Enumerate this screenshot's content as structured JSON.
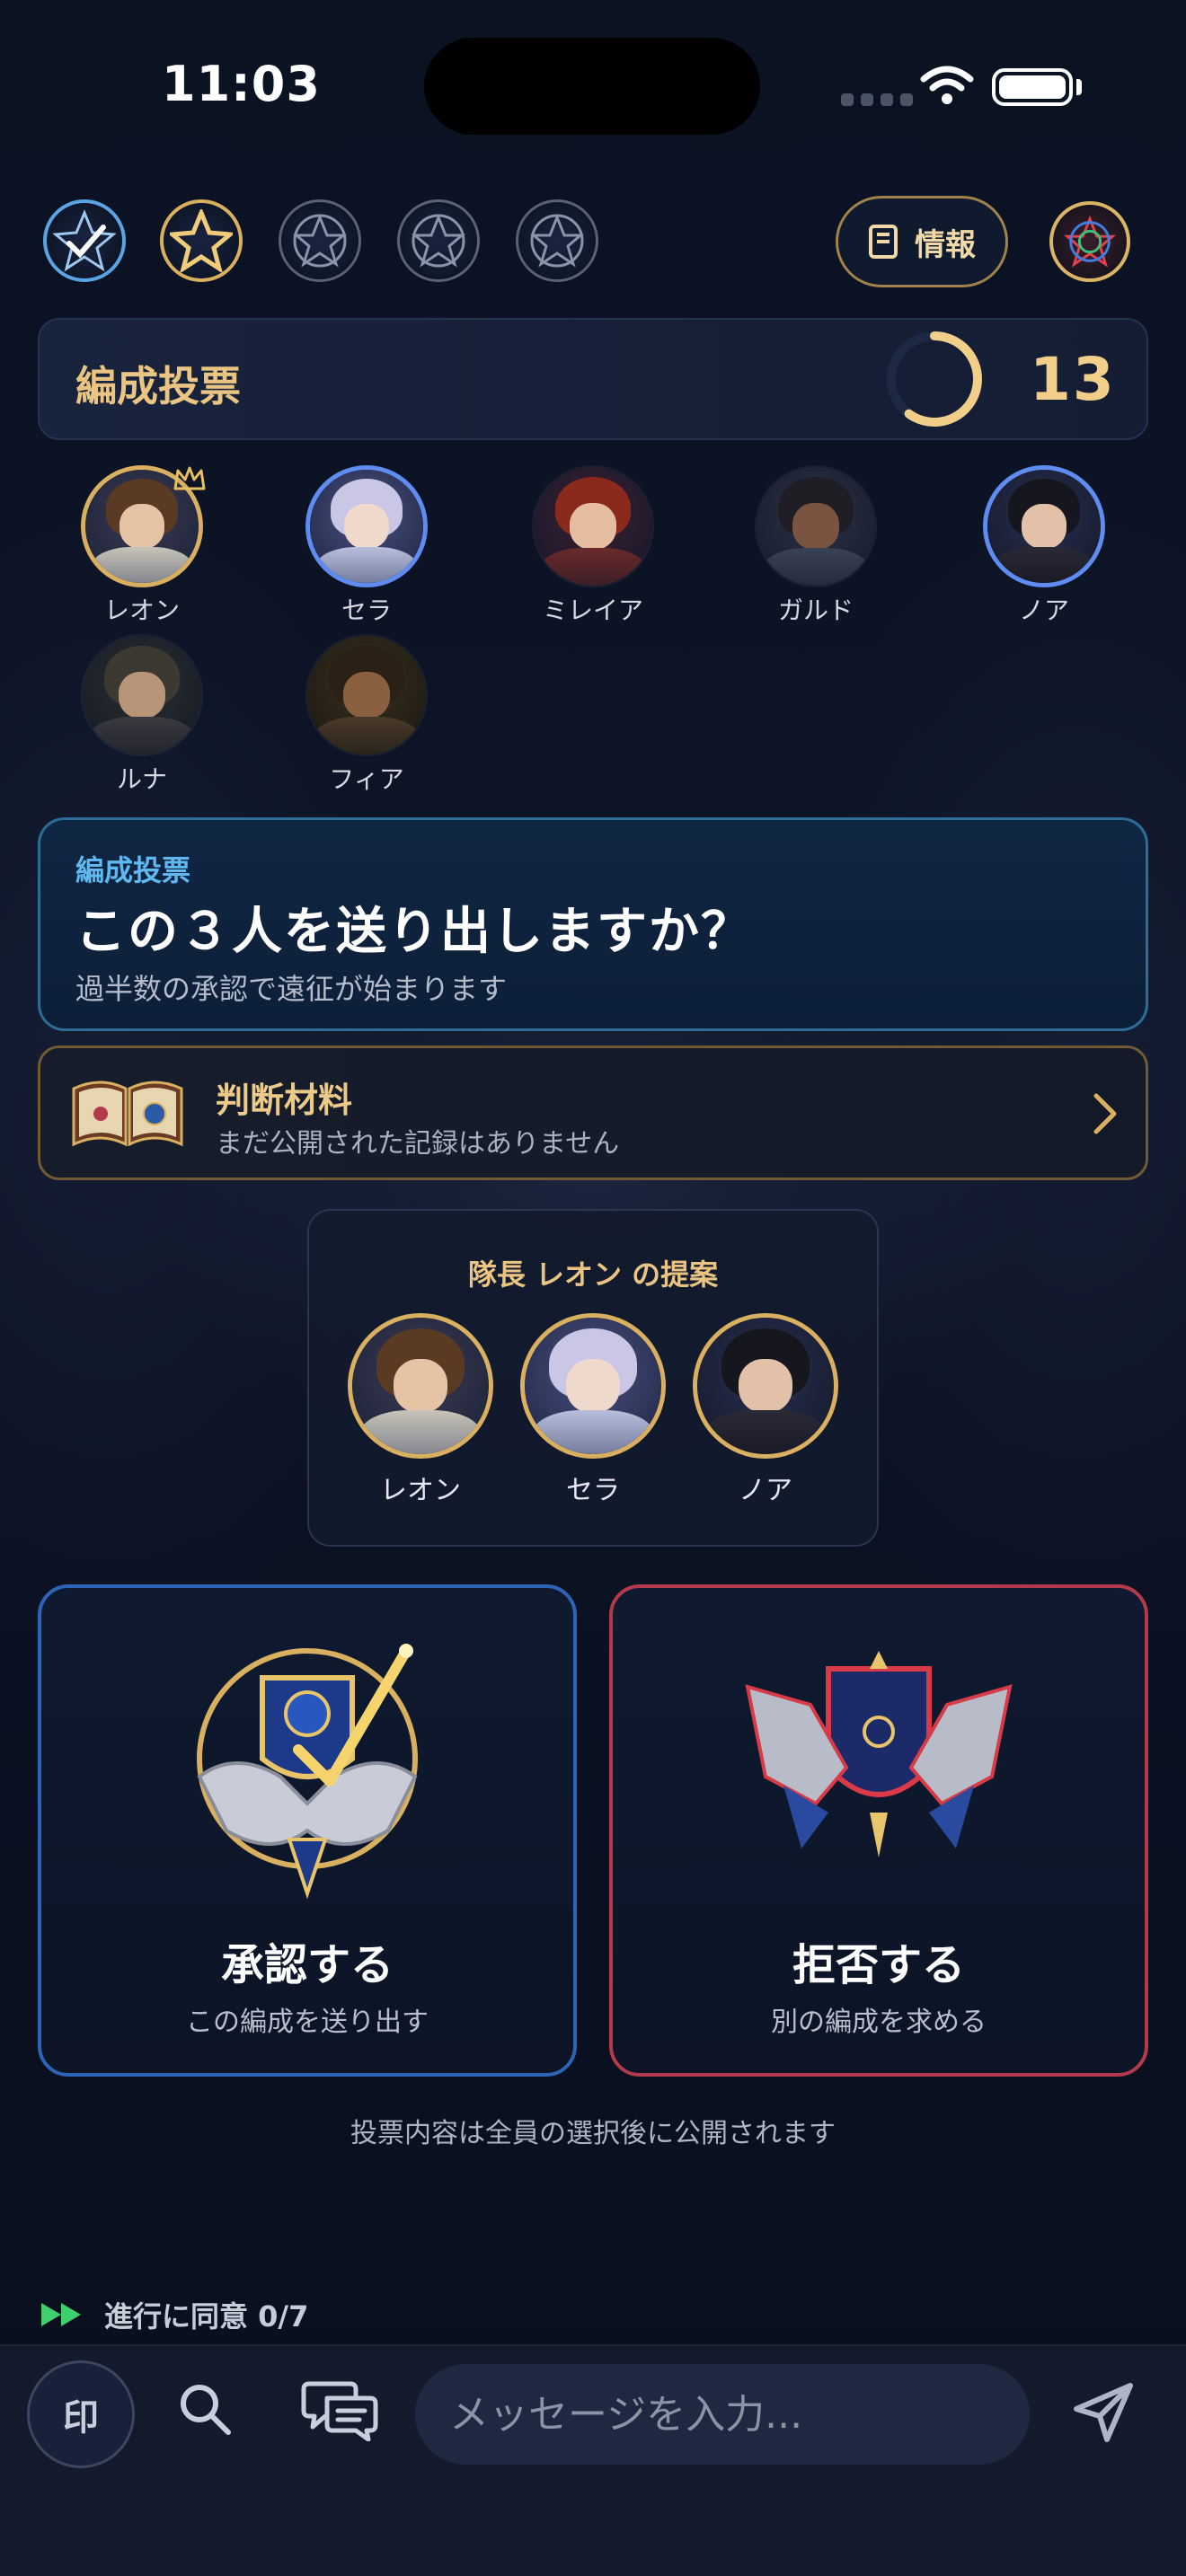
{
  "status_bar": {
    "time": "11:03"
  },
  "top": {
    "role_icons": [
      "check-star-icon",
      "star-icon",
      "pentagram-icon",
      "pentagram-icon",
      "pentagram-icon"
    ],
    "info_label": "情報",
    "emblem_icon": "tri-color-pentagram-icon"
  },
  "header": {
    "title": "編成投票",
    "timer": "13",
    "timer_progress": 0.6
  },
  "members": [
    {
      "name": "レオン",
      "ring": "gold",
      "leader": true
    },
    {
      "name": "セラ",
      "ring": "blue",
      "leader": false
    },
    {
      "name": "ミレイア",
      "ring": "none",
      "leader": false
    },
    {
      "name": "ガルド",
      "ring": "none",
      "leader": false
    },
    {
      "name": "ノア",
      "ring": "blue",
      "leader": false
    },
    {
      "name": "ルナ",
      "ring": "none",
      "leader": false
    },
    {
      "name": "フィア",
      "ring": "none",
      "leader": false
    }
  ],
  "vote_banner": {
    "kicker": "編成投票",
    "title": "この３人を送り出しますか？",
    "subtitle": "過半数の承認で遠征が始まります"
  },
  "judgment": {
    "title": "判断材料",
    "subtitle": "まだ公開された記録はありません"
  },
  "proposal": {
    "title": "隊長 レオン の提案",
    "members": [
      "レオン",
      "セラ",
      "ノア"
    ]
  },
  "choices": {
    "approve": {
      "label": "承認する",
      "sub": "この編成を送り出す"
    },
    "reject": {
      "label": "拒否する",
      "sub": "別の編成を求める"
    }
  },
  "disclosure_note": "投票内容は全員の選択後に公開されます",
  "progress": {
    "text": "進行に同意 0/7"
  },
  "bottom": {
    "seal_label": "印",
    "message_placeholder": "メッセージを入力..."
  },
  "colors": {
    "gold": "#d9b060",
    "blue_ring": "#5f8cf0",
    "approve_border": "#2e64b8",
    "reject_border": "#b23a4a",
    "kicker_blue": "#5fb8f0"
  }
}
